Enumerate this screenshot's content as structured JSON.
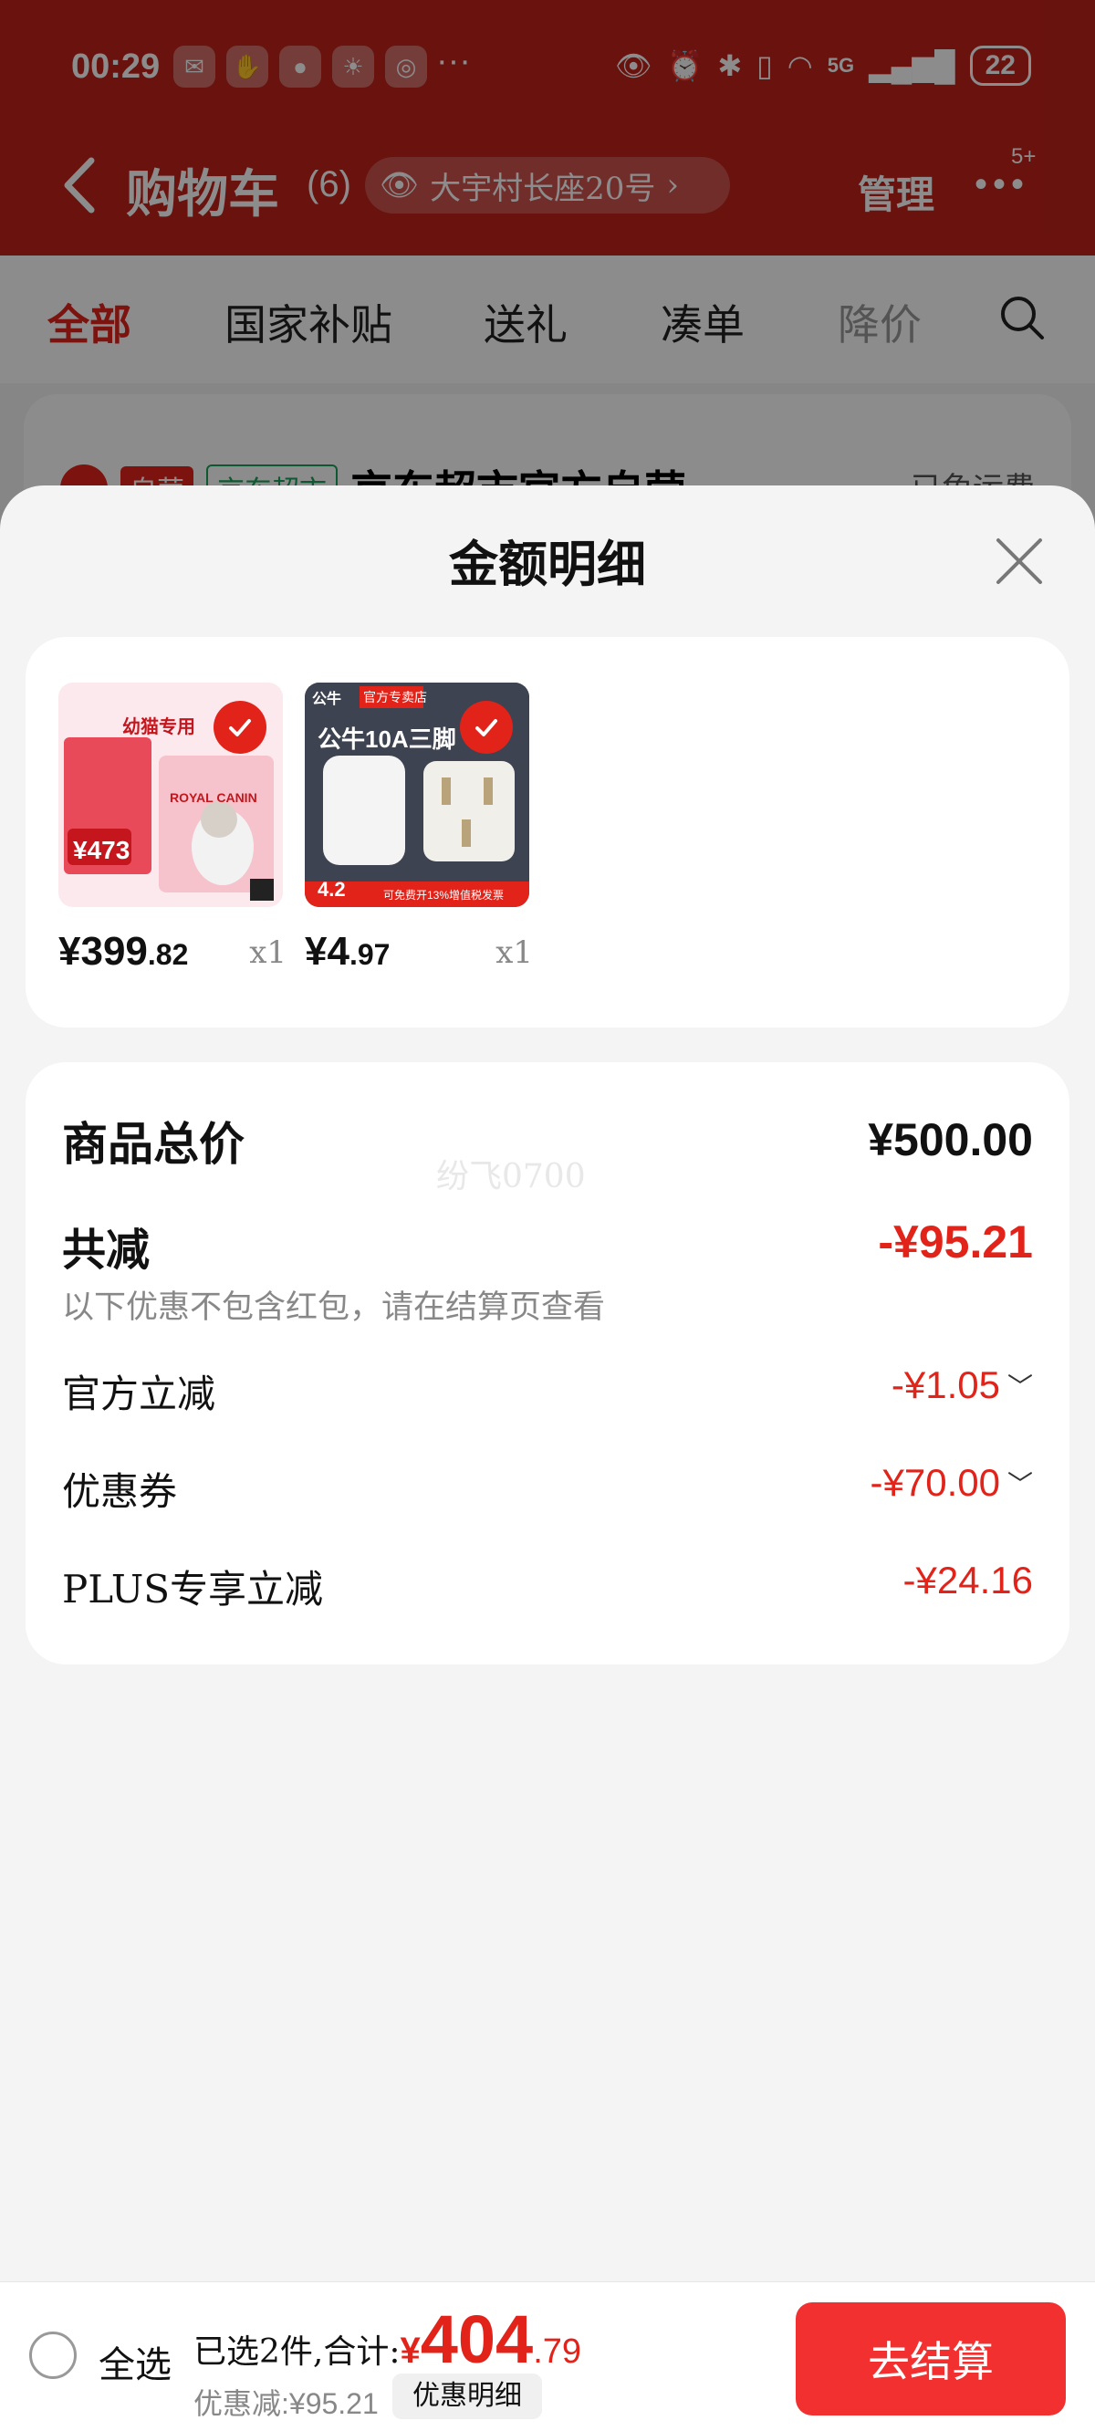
{
  "status_bar": {
    "time": "00:29",
    "app_icons": [
      "wechat-icon",
      "hand-icon",
      "message-icon",
      "weather-icon",
      "mobile-app-icon"
    ],
    "more": "···",
    "network": "5G",
    "battery": "22"
  },
  "nav": {
    "title": "购物车",
    "count": "(6)",
    "address": "大宇村长座20号",
    "manage": "管理",
    "badge": "5+"
  },
  "tabs": [
    {
      "label": "全部"
    },
    {
      "label": "国家补贴"
    },
    {
      "label": "送礼"
    },
    {
      "label": "凑单"
    },
    {
      "label": "降价"
    }
  ],
  "store": {
    "tag_self": "自营",
    "tag_market": "京东超市",
    "name": "京东超市官方自营",
    "shipping": "已免运费"
  },
  "sheet": {
    "title": "金额明细",
    "products": [
      {
        "price_int": "¥399",
        "price_cents": ".82",
        "qty": "x1",
        "img_title": "幼猫专用",
        "img_brand": "ROYAL CANIN",
        "img_badge_price": "¥473"
      },
      {
        "price_int": "¥4",
        "price_cents": ".97",
        "qty": "x1",
        "img_store": "公牛",
        "img_store_tag": "官方专卖店",
        "img_title": "公牛10A三脚",
        "img_badge_price": "4.2",
        "img_footer": "可免费开13%增值税发票"
      }
    ],
    "watermark": "纷飞0700",
    "total": {
      "label": "商品总价",
      "value": "¥500.00"
    },
    "discount": {
      "label": "共减",
      "value": "-¥95.21",
      "note": "以下优惠不包含红包，请在结算页查看"
    },
    "details": [
      {
        "label": "官方立减",
        "value": "-¥1.05",
        "expandable": true
      },
      {
        "label": "优惠券",
        "value": "-¥70.00",
        "expandable": true
      },
      {
        "label": "PLUS专享立减",
        "value": "-¥24.16",
        "expandable": false
      }
    ]
  },
  "bottom_bar": {
    "select_all": "全选",
    "selected_text": "已选2件,合计:",
    "currency": "¥",
    "total_int": "404",
    "total_cents": ".79",
    "saved": "优惠减:¥95.21",
    "detail_chip": "优惠明细",
    "checkout": "去结算"
  },
  "colors": {
    "header_red": "#c0221b",
    "accent_red": "#e2231a",
    "checkout_red": "#f23030"
  }
}
